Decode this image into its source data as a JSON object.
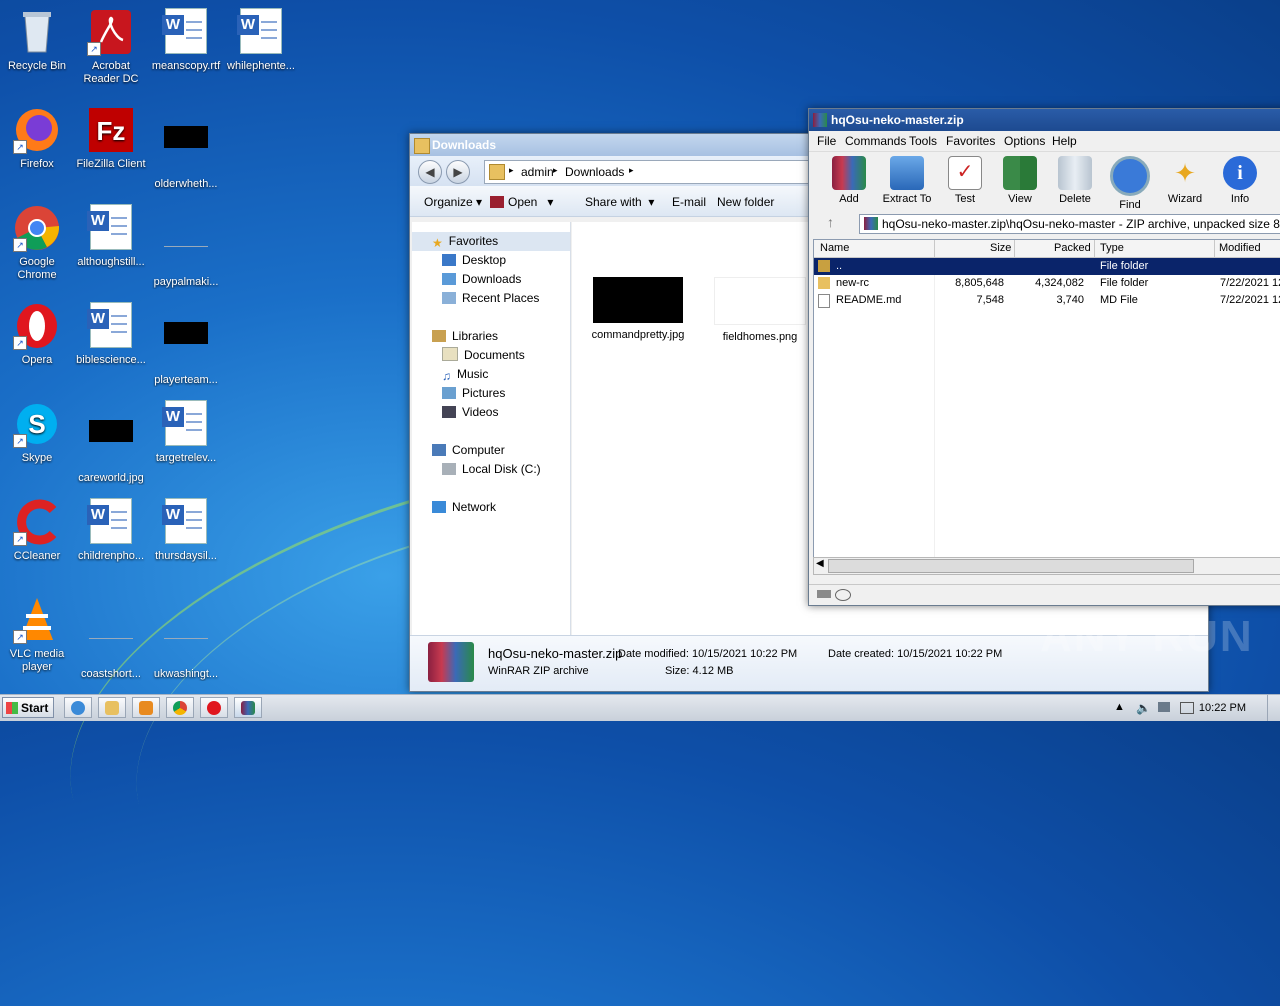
{
  "desktop": {
    "icons": [
      {
        "label": "Recycle Bin",
        "icon": "recycle-bin-icon"
      },
      {
        "label": "Acrobat Reader DC",
        "icon": "acrobat-icon"
      },
      {
        "label": "meanscopy.rtf",
        "icon": "word-doc-icon"
      },
      {
        "label": "whilephente...",
        "icon": "word-doc-icon"
      },
      {
        "label": "Firefox",
        "icon": "firefox-icon"
      },
      {
        "label": "FileZilla Client",
        "icon": "filezilla-icon"
      },
      {
        "label": "olderwheth...",
        "icon": "black-thumb-icon"
      },
      {
        "label": "Google Chrome",
        "icon": "chrome-icon"
      },
      {
        "label": "althoughstill...",
        "icon": "word-doc-icon"
      },
      {
        "label": "paypalmaki...",
        "icon": "blank-thumb-icon"
      },
      {
        "label": "Opera",
        "icon": "opera-icon"
      },
      {
        "label": "biblescience...",
        "icon": "word-doc-icon"
      },
      {
        "label": "playerteam...",
        "icon": "black-thumb-icon"
      },
      {
        "label": "Skype",
        "icon": "skype-icon"
      },
      {
        "label": "careworld.jpg",
        "icon": "black-thumb-icon"
      },
      {
        "label": "targetrelev...",
        "icon": "word-doc-icon"
      },
      {
        "label": "CCleaner",
        "icon": "ccleaner-icon"
      },
      {
        "label": "childrenpho...",
        "icon": "word-doc-icon"
      },
      {
        "label": "thursdaysil...",
        "icon": "word-doc-icon"
      },
      {
        "label": "VLC media player",
        "icon": "vlc-icon"
      },
      {
        "label": "coastshort...",
        "icon": "blank-thumb-icon"
      },
      {
        "label": "ukwashingt...",
        "icon": "blank-thumb-icon"
      }
    ]
  },
  "explorer": {
    "title": "Downloads",
    "breadcrumb": [
      "admin",
      "Downloads"
    ],
    "commands": [
      "Organize",
      "Open",
      "Share with",
      "E-mail",
      "New folder"
    ],
    "nav": {
      "favorites": "Favorites",
      "fav_items": [
        "Desktop",
        "Downloads",
        "Recent Places"
      ],
      "libraries": "Libraries",
      "lib_items": [
        "Documents",
        "Music",
        "Pictures",
        "Videos"
      ],
      "computer": "Computer",
      "computer_items": [
        "Local Disk (C:)"
      ],
      "network": "Network"
    },
    "files": [
      {
        "name": "commandpretty.jpg"
      },
      {
        "name": "fieldhomes.png"
      }
    ],
    "details": {
      "name": "hqOsu-neko-master.zip",
      "type": "WinRAR ZIP archive",
      "modified_label": "Date modified:",
      "modified": "10/15/2021 10:22 PM",
      "created_label": "Date created:",
      "created": "10/15/2021 10:22 PM",
      "size_label": "Size:",
      "size": "4.12 MB"
    }
  },
  "winrar": {
    "title": "hqOsu-neko-master.zip",
    "menu": [
      "File",
      "Commands",
      "Tools",
      "Favorites",
      "Options",
      "Help"
    ],
    "toolbar": [
      "Add",
      "Extract To",
      "Test",
      "View",
      "Delete",
      "Find",
      "Wizard",
      "Info"
    ],
    "path": "hqOsu-neko-master.zip\\hqOsu-neko-master - ZIP archive, unpacked size 8,813,19",
    "columns": [
      "Name",
      "Size",
      "Packed",
      "Type",
      "Modified"
    ],
    "rows": [
      {
        "name": "..",
        "size": "",
        "packed": "",
        "type": "File folder",
        "modified": ""
      },
      {
        "name": "new-rc",
        "size": "8,805,648",
        "packed": "4,324,082",
        "type": "File folder",
        "modified": "7/22/2021 12"
      },
      {
        "name": "README.md",
        "size": "7,548",
        "packed": "3,740",
        "type": "MD File",
        "modified": "7/22/2021 12"
      }
    ]
  },
  "taskbar": {
    "start": "Start",
    "time": "10:22 PM"
  },
  "watermark": "ANY RUN"
}
